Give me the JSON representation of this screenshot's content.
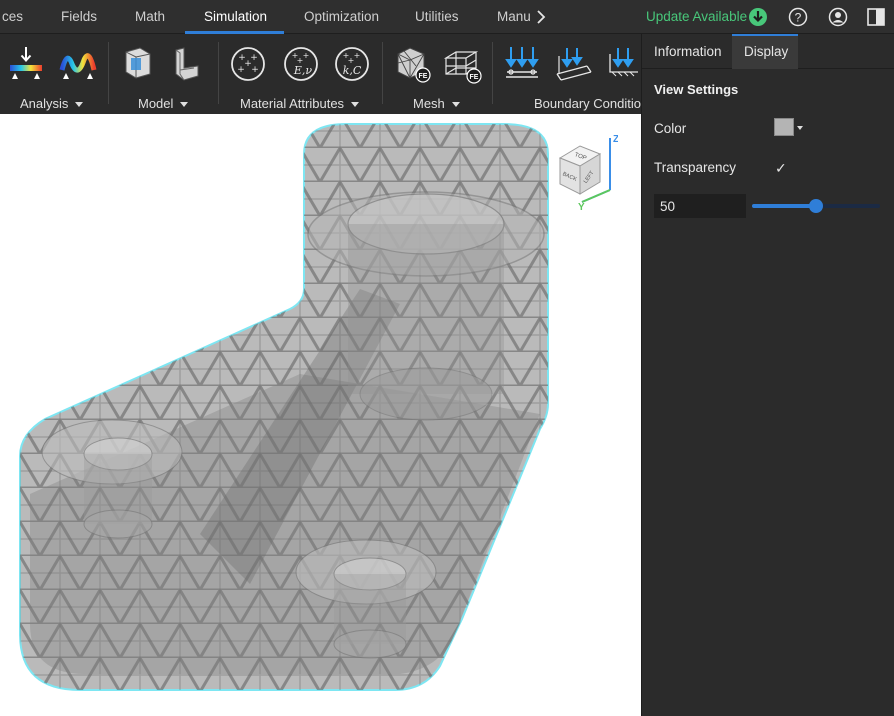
{
  "tabs": [
    {
      "label": "ces"
    },
    {
      "label": "Fields"
    },
    {
      "label": "Math"
    },
    {
      "label": "Simulation"
    },
    {
      "label": "Optimization"
    },
    {
      "label": "Utilities"
    },
    {
      "label": "Manuf"
    }
  ],
  "active_tab": "Simulation",
  "header": {
    "update_label": "Update Available",
    "icons": [
      "download-icon",
      "help-icon",
      "account-icon",
      "panel-toggle-icon"
    ]
  },
  "ribbon": {
    "groups": [
      {
        "label": "Analysis",
        "icons": [
          "static-analysis-icon",
          "modal-analysis-icon"
        ]
      },
      {
        "label": "Model",
        "icons": [
          "model-body-icon",
          "model-shell-icon"
        ]
      },
      {
        "label": "Material Attributes",
        "icons": [
          "material-icon",
          "material-elastic-icon",
          "material-thermal-icon"
        ]
      },
      {
        "label": "Mesh",
        "icons": [
          "fe-mesh-solid-icon",
          "fe-mesh-wire-icon"
        ]
      },
      {
        "label": "Boundary Condition",
        "icons": [
          "force-load-icon",
          "distributed-load-icon",
          "pressure-load-icon"
        ]
      }
    ],
    "mesh_badge": "FE",
    "material_elastic_text": "E,ν",
    "material_thermal_text": "k,C"
  },
  "viewcube": {
    "top": "TOP",
    "back": "BACK",
    "left": "LEFT",
    "z": "Z",
    "y": "Y"
  },
  "panel": {
    "tabs": [
      {
        "label": "Information"
      },
      {
        "label": "Display"
      }
    ],
    "active_tab": "Display",
    "section_title": "View Settings",
    "color_label": "Color",
    "color_value": "#b4b4b4",
    "transparency_label": "Transparency",
    "transparency_checked": true,
    "transparency_check_glyph": "✓",
    "transparency_value": "50",
    "slider_fraction": 0.5
  },
  "colors": {
    "accent": "#2f7ed8",
    "update_green": "#48c77a",
    "outline_cyan": "#5ee0f0",
    "part_gray": "#9a9a9a"
  }
}
